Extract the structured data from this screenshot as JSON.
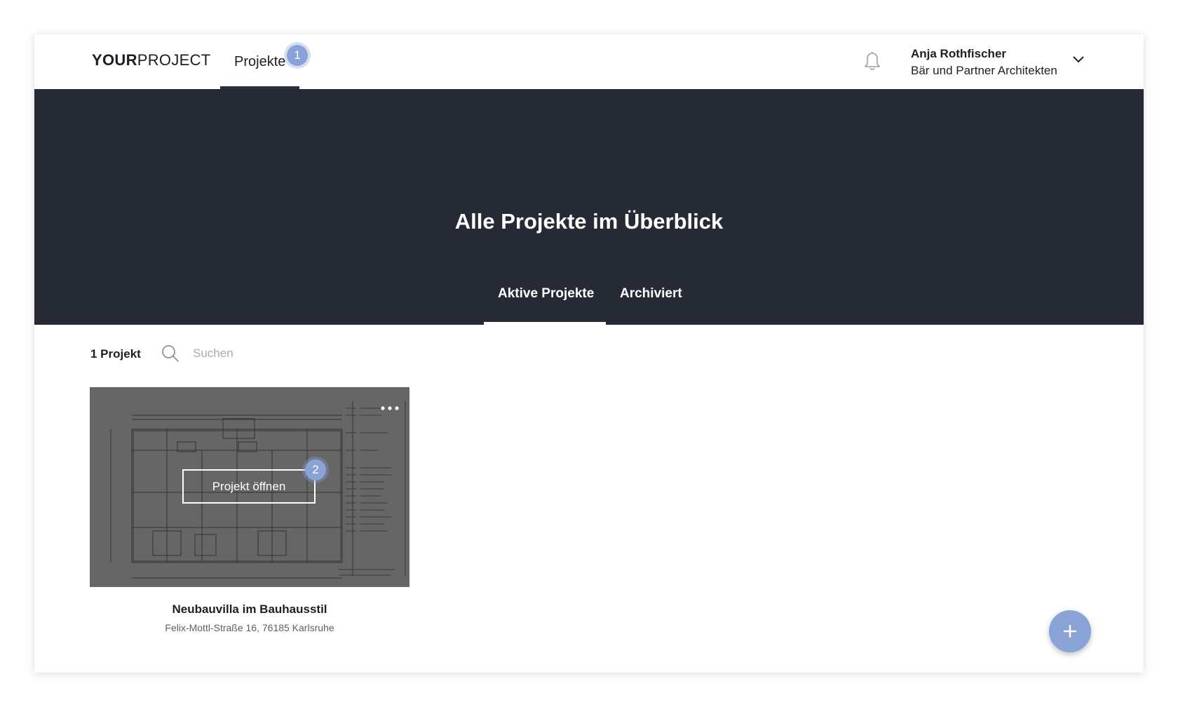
{
  "header": {
    "logo_bold": "YOUR",
    "logo_light": "PROJECT",
    "nav": [
      {
        "label": "Projekte",
        "active": true,
        "step": "1"
      }
    ],
    "user": {
      "name": "Anja Rothfischer",
      "company": "Bär und Partner Architekten"
    },
    "icons": {
      "notifications": "bell-icon",
      "user_menu": "chevron-down-icon"
    }
  },
  "hero": {
    "title": "Alle Projekte im Überblick",
    "tabs": [
      {
        "label": "Aktive Projekte",
        "active": true
      },
      {
        "label": "Archiviert",
        "active": false
      }
    ]
  },
  "toolbar": {
    "count": "1 Projekt",
    "search": {
      "placeholder": "Suchen",
      "value": ""
    },
    "search_icon": "search-icon"
  },
  "projects": [
    {
      "title": "Neubauvilla im Bauhausstil",
      "address": "Felix-Mottl-Straße 16, 76185 Karlsruhe",
      "open_label": "Projekt öffnen",
      "step": "2",
      "menu_icon": "more-horizontal-icon"
    }
  ],
  "fab": {
    "icon": "plus-icon"
  },
  "colors": {
    "hero_bg": "#252a35",
    "accent": "#8aa3d6",
    "text": "#1c1f24",
    "muted": "#5b5f66"
  }
}
